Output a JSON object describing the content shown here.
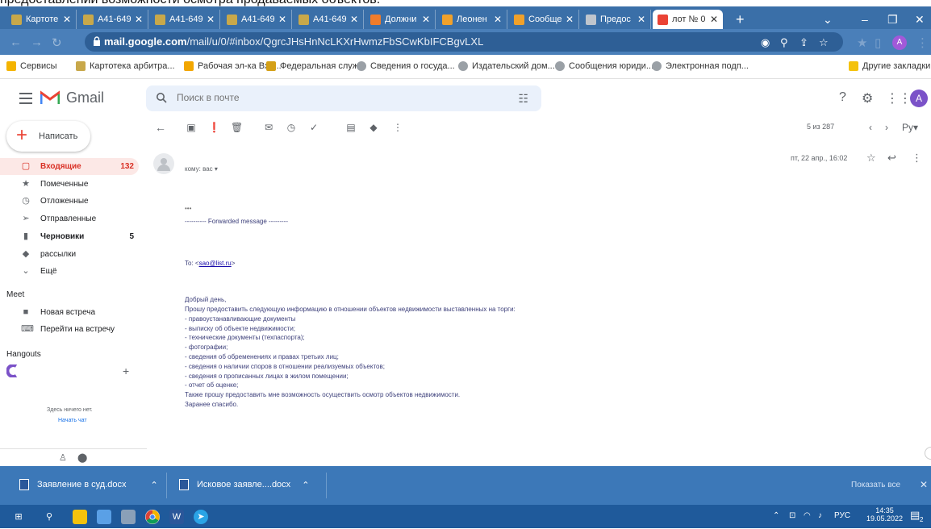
{
  "page_caption": "предоставлении возможности осмотра продаваемых объектов.",
  "browser": {
    "tabs": [
      {
        "label": "Картоте",
        "favicon": "building-favicon",
        "color": "#c8a84a"
      },
      {
        "label": "А41-649",
        "favicon": "building-favicon",
        "color": "#c8a84a"
      },
      {
        "label": "А41-649",
        "favicon": "building-favicon",
        "color": "#c8a84a"
      },
      {
        "label": "А41-649",
        "favicon": "building-favicon",
        "color": "#c8a84a"
      },
      {
        "label": "А41-649",
        "favicon": "building-favicon",
        "color": "#c8a84a"
      },
      {
        "label": "Должни",
        "favicon": "orange-favicon",
        "color": "#f07c2b"
      },
      {
        "label": "Леонен",
        "favicon": "orange-favicon",
        "color": "#f0a12b"
      },
      {
        "label": "Сообще",
        "favicon": "orange-favicon",
        "color": "#f0a12b"
      },
      {
        "label": "Предос",
        "favicon": "globe-favicon",
        "color": "#bfc5cd"
      },
      {
        "label": "лот № 0",
        "favicon": "gmail-favicon",
        "color": "#ea4335",
        "active": true
      }
    ],
    "url_host": "mail.google.com",
    "url_path": "/mail/u/0/#inbox/QgrcJHsHnNcLKXrHwmzFbSCwKbIFCBgvLXL",
    "profile_initial": "A",
    "bookmarks": [
      {
        "label": "Сервисы",
        "icon": "apps-grid-icon"
      },
      {
        "label": "Картотека арбитра...",
        "icon": "building-icon"
      },
      {
        "label": "Рабочая эл-ка Вхо...",
        "icon": "mail-icon"
      },
      {
        "label": "Федеральная служ...",
        "icon": "emblem-icon"
      },
      {
        "label": "Сведения о госуда...",
        "icon": "globe-icon"
      },
      {
        "label": "Издательский дом...",
        "icon": "globe-icon"
      },
      {
        "label": "Сообщения юриди...",
        "icon": "globe-icon"
      },
      {
        "label": "Электронная подп...",
        "icon": "globe-icon"
      }
    ],
    "other_bookmarks": "Другие закладки"
  },
  "gmail": {
    "brand": "Gmail",
    "search_placeholder": "Поиск в почте",
    "avatar_initial": "A",
    "compose_label": "Написать",
    "nav": [
      {
        "label": "Входящие",
        "count": "132",
        "icon": "inbox-icon",
        "active": true
      },
      {
        "label": "Помеченные",
        "count": "",
        "icon": "star-icon"
      },
      {
        "label": "Отложенные",
        "count": "",
        "icon": "clock-icon"
      },
      {
        "label": "Отправленные",
        "count": "",
        "icon": "send-icon"
      },
      {
        "label": "Черновики",
        "count": "5",
        "icon": "draft-icon",
        "bold": true
      },
      {
        "label": "рассылки",
        "count": "",
        "icon": "label-icon"
      },
      {
        "label": "Ещё",
        "count": "",
        "icon": "chevron-down-icon"
      }
    ],
    "meet": {
      "title": "Meet",
      "items": [
        {
          "label": "Новая встреча",
          "icon": "video-icon"
        },
        {
          "label": "Перейти на встречу",
          "icon": "keyboard-icon"
        }
      ]
    },
    "hangouts": {
      "title": "Hangouts",
      "empty_text": "Здесь ничего нет.",
      "start_chat": "Начать чат"
    },
    "pager": "5 из 287",
    "message": {
      "to_label": "кому: вас",
      "date": "пт, 22 апр., 16:02",
      "ellipsis": "•••",
      "forwarded": "---------- Forwarded message ---------",
      "to_line_prefix": "To: <",
      "to_line_email": "sao@list.ru",
      "to_line_suffix": ">",
      "greeting": "Добрый день,",
      "body": [
        "Прошу предоставить следующую информацию в отношении  объектов недвижимости выставленных на торги:",
        "- правоустанавливающие документы",
        "- выписку об объекте недвижимости;",
        "- технические документы (техпаспорта);",
        "- фотографии;",
        "- сведения об обременениях и правах третьих лиц;",
        "- сведения о наличии споров в отношении реализуемых объектов;",
        "- сведения о прописанных лицах в жилом помещении;",
        "- отчет об оценке;",
        "Также прошу предоставить мне возможность осуществить осмотр объектов недвижимости.",
        "Заранее спасибо."
      ]
    }
  },
  "downloads": {
    "items": [
      "Заявление в суд.docx",
      "Исковое заявле....docx"
    ],
    "show_all": "Показать все"
  },
  "taskbar": {
    "lang": "РУС",
    "time": "14:35",
    "date": "19.05.2022",
    "notif_count": "2"
  }
}
